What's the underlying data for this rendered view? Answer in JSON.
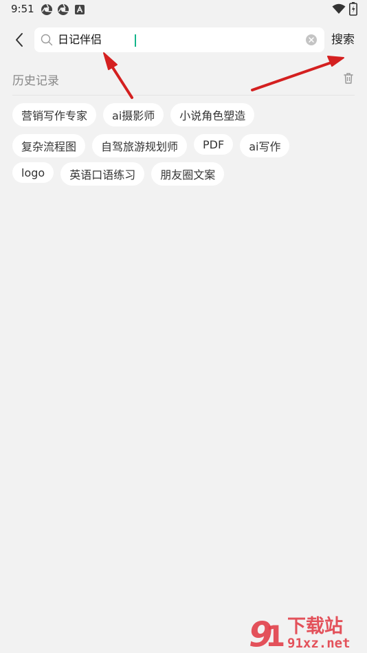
{
  "status_bar": {
    "time": "9:51"
  },
  "search": {
    "value": "日记伴侣",
    "button_label": "搜索"
  },
  "history": {
    "title": "历史记录",
    "tags": [
      "营销写作专家",
      "ai摄影师",
      "小说角色塑造",
      "复杂流程图",
      "自驾旅游规划师",
      "PDF",
      "ai写作",
      "logo",
      "英语口语练习",
      "朋友圈文案"
    ]
  },
  "watermark": {
    "brand": "下载站",
    "domain": "91xz.net"
  },
  "colors": {
    "background": "#f2f2f2",
    "chip": "#ffffff",
    "caret": "#13b58a",
    "arrow": "#d42020",
    "watermark": "#e2404a"
  },
  "icons": [
    "chrome-icon",
    "chrome-icon",
    "a-app-icon",
    "wifi-icon",
    "battery-icon",
    "back-arrow-icon",
    "search-icon",
    "clear-icon",
    "trash-icon"
  ]
}
